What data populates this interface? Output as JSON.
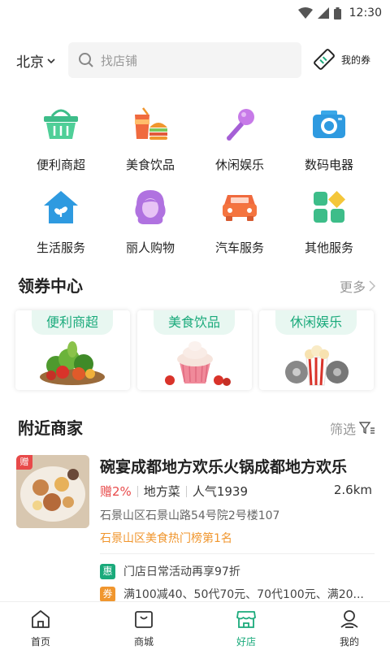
{
  "status_bar": {
    "time": "12:30"
  },
  "header": {
    "city": "北京",
    "search_placeholder": "找店铺",
    "coupon_label": "我的券"
  },
  "categories": [
    {
      "label": "便利商超",
      "icon": "basket-icon"
    },
    {
      "label": "美食饮品",
      "icon": "food-drink-icon"
    },
    {
      "label": "休闲娱乐",
      "icon": "microphone-icon"
    },
    {
      "label": "数码电器",
      "icon": "camera-icon"
    },
    {
      "label": "生活服务",
      "icon": "house-icon"
    },
    {
      "label": "丽人购物",
      "icon": "beauty-icon"
    },
    {
      "label": "汽车服务",
      "icon": "car-icon"
    },
    {
      "label": "其他服务",
      "icon": "grid-icon"
    }
  ],
  "coupon_center": {
    "title": "领券中心",
    "more": "更多",
    "cards": [
      {
        "tag": "便利商超"
      },
      {
        "tag": "美食饮品"
      },
      {
        "tag": "休闲娱乐"
      }
    ]
  },
  "nearby": {
    "title": "附近商家",
    "filter": "筛选",
    "merchant": {
      "badge": "赠",
      "name": "碗宴成都地方欢乐火锅成都地方欢乐",
      "give": "赠2%",
      "cuisine": "地方菜",
      "popularity": "人气1939",
      "distance": "2.6km",
      "address": "石景山区石景山路54号院2号楼107",
      "rank": "石景山区美食热门榜第1名",
      "promos": [
        {
          "badge": "惠",
          "color": "#1aaa7b",
          "text": "门店日常活动再享97折"
        },
        {
          "badge": "券",
          "color": "#f0962e",
          "text": "满100减40、50代70元、70代100元、满20..."
        }
      ]
    }
  },
  "bottom_nav": [
    {
      "label": "首页",
      "icon": "home-icon",
      "active": false
    },
    {
      "label": "商城",
      "icon": "shopping-bag-icon",
      "active": false
    },
    {
      "label": "好店",
      "icon": "store-icon",
      "active": true
    },
    {
      "label": "我的",
      "icon": "profile-icon",
      "active": false
    }
  ],
  "colors": {
    "accent": "#1aaa7b",
    "red": "#e84a4a",
    "orange": "#f0962e"
  }
}
